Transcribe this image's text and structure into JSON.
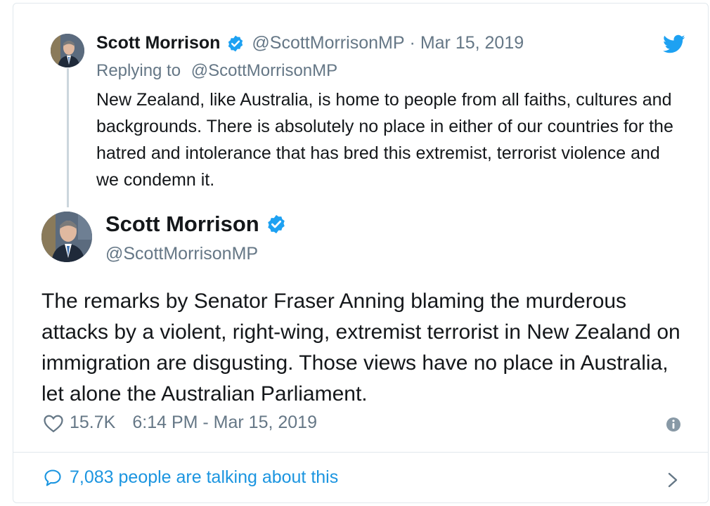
{
  "reply_tweet": {
    "author_name": "Scott Morrison",
    "handle": "@ScottMorrisonMP",
    "separator": "·",
    "date": "Mar 15, 2019",
    "replying_prefix": "Replying to",
    "replying_handle": "@ScottMorrisonMP",
    "text": "New Zealand, like Australia, is home to people from all faiths, cultures and backgrounds. There is absolutely no place in either of our countries for the hatred and intolerance that has bred this extremist, terrorist violence and we condemn it."
  },
  "main_tweet": {
    "author_name": "Scott Morrison",
    "handle": "@ScottMorrisonMP",
    "text": "The remarks by Senator Fraser Anning blaming the murderous attacks by a violent, right-wing, extremist terrorist in New Zealand on immigration are disgusting. Those views have no place in Australia, let alone the Australian Parliament.",
    "likes": "15.7K",
    "timestamp": "6:14 PM - Mar 15, 2019"
  },
  "footer": {
    "talking_text": "7,083 people are talking about this"
  },
  "icons": {
    "twitter": "twitter-bird-icon",
    "verified": "verified-badge-icon",
    "like": "heart-icon",
    "info": "info-icon",
    "comment": "speech-bubble-icon",
    "chevron": "chevron-right-icon"
  },
  "colors": {
    "twitter_blue": "#1da1f2",
    "link_blue": "#1b95e0",
    "secondary_text": "#657786",
    "primary_text": "#14171a",
    "border": "#e1e8ed"
  }
}
